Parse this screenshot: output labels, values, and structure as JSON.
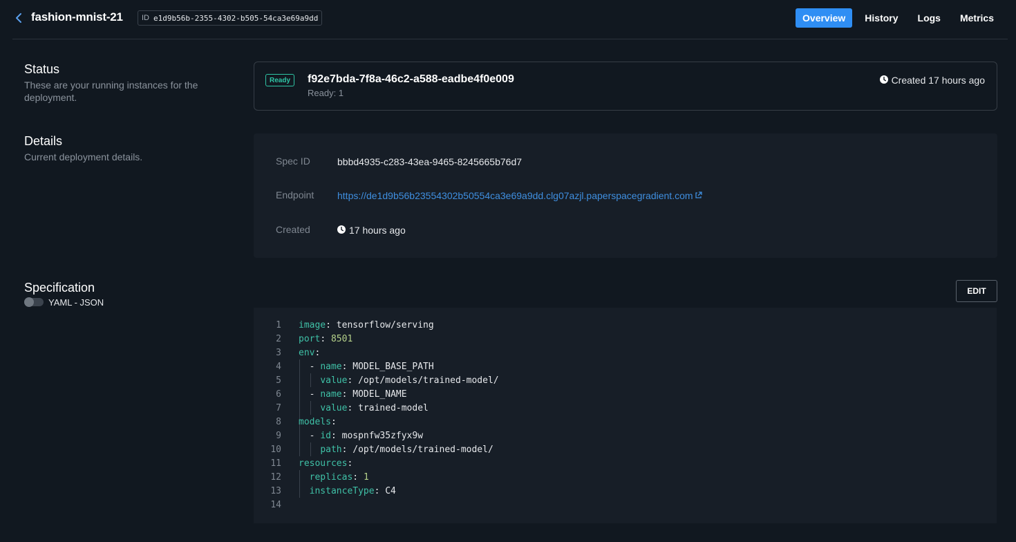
{
  "header": {
    "title": "fashion-mnist-21",
    "id_label": "ID",
    "id_value": "e1d9b56b-2355-4302-b505-54ca3e69a9dd",
    "tabs": [
      {
        "label": "Overview",
        "active": true
      },
      {
        "label": "History",
        "active": false
      },
      {
        "label": "Logs",
        "active": false
      },
      {
        "label": "Metrics",
        "active": false
      }
    ]
  },
  "status": {
    "title": "Status",
    "description": "These are your running instances for the deployment.",
    "badge": "Ready",
    "instance_id": "f92e7bda-7f8a-46c2-a588-eadbe4f0e009",
    "ready_count": "Ready: 1",
    "created": "Created 17 hours ago"
  },
  "details": {
    "title": "Details",
    "description": "Current deployment details.",
    "spec_id_label": "Spec ID",
    "spec_id_value": "bbbd4935-c283-43ea-9465-8245665b76d7",
    "endpoint_label": "Endpoint",
    "endpoint_value": "https://de1d9b56b23554302b50554ca3e69a9dd.clg07azjl.paperspacegradient.com",
    "created_label": "Created",
    "created_value": "17 hours ago"
  },
  "specification": {
    "title": "Specification",
    "toggle_label": "YAML - JSON",
    "edit_label": "EDIT",
    "lines": [
      {
        "n": "1",
        "indent": "",
        "key": "image",
        "sep": ": ",
        "val": "tensorflow/serving",
        "num": false
      },
      {
        "n": "2",
        "indent": "",
        "key": "port",
        "sep": ": ",
        "val": "8501",
        "num": true
      },
      {
        "n": "3",
        "indent": "",
        "key": "env",
        "sep": ":",
        "val": "",
        "num": false
      },
      {
        "n": "4",
        "indent": "  - ",
        "key": "name",
        "sep": ": ",
        "val": "MODEL_BASE_PATH",
        "num": false
      },
      {
        "n": "5",
        "indent": "    ",
        "key": "value",
        "sep": ": ",
        "val": "/opt/models/trained-model/",
        "num": false
      },
      {
        "n": "6",
        "indent": "  - ",
        "key": "name",
        "sep": ": ",
        "val": "MODEL_NAME",
        "num": false
      },
      {
        "n": "7",
        "indent": "    ",
        "key": "value",
        "sep": ": ",
        "val": "trained-model",
        "num": false
      },
      {
        "n": "8",
        "indent": "",
        "key": "models",
        "sep": ":",
        "val": "",
        "num": false
      },
      {
        "n": "9",
        "indent": "  - ",
        "key": "id",
        "sep": ": ",
        "val": "mospnfw35zfyx9w",
        "num": false
      },
      {
        "n": "10",
        "indent": "    ",
        "key": "path",
        "sep": ": ",
        "val": "/opt/models/trained-model/",
        "num": false
      },
      {
        "n": "11",
        "indent": "",
        "key": "resources",
        "sep": ":",
        "val": "",
        "num": false
      },
      {
        "n": "12",
        "indent": "  ",
        "key": "replicas",
        "sep": ": ",
        "val": "1",
        "num": true
      },
      {
        "n": "13",
        "indent": "  ",
        "key": "instanceType",
        "sep": ": ",
        "val": "C4",
        "num": false
      },
      {
        "n": "14",
        "indent": "",
        "key": "",
        "sep": "",
        "val": "",
        "num": false
      }
    ]
  },
  "colors": {
    "accent": "#2f8ef4",
    "ready": "#2fc5a5",
    "link": "#3f8fe0",
    "yaml_key": "#3fc1a7"
  }
}
